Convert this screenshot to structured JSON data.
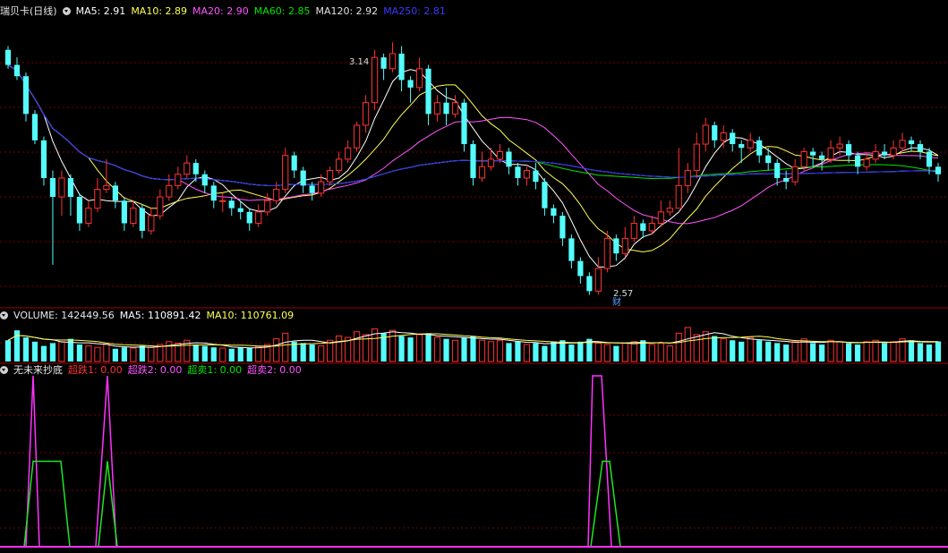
{
  "colors": {
    "up": "#ff3232",
    "down": "#54fcfc",
    "ma5": "#ffffff",
    "ma10": "#ffff54",
    "ma20": "#ff54ff",
    "ma60": "#00e600",
    "ma120": "#d8d8d8",
    "ma250": "#2a2aff",
    "grid": "#7a0000",
    "axis": "#a00000"
  },
  "price_header": {
    "title": "瑞贝卡(日线)",
    "ma5": "MA5: 2.91",
    "ma10": "MA10: 2.89",
    "ma20": "MA20: 2.90",
    "ma60": "MA60: 2.85",
    "ma120": "MA120: 2.92",
    "ma250": "MA250: 2.81"
  },
  "volume_header": {
    "volume": "VOLUME: 142449.56",
    "ma5": "MA5: 110891.42",
    "ma10": "MA10: 110761.09"
  },
  "indicator_header": {
    "name": "无未来抄底",
    "s1": "超跌1: 0.00",
    "s2": "超跌2: 0.00",
    "s3": "超卖1: 0.00",
    "s4": "超卖2: 0.00"
  },
  "chart_data": [
    {
      "type": "candlestick",
      "annotations": [
        {
          "text": "3.14",
          "kind": "high"
        },
        {
          "text": "2.57",
          "kind": "low"
        },
        {
          "text": "财",
          "kind": "marker"
        }
      ],
      "ohlc_sample_note": "",
      "candles": [
        [
          3.22,
          3.18,
          3.23,
          3.17
        ],
        [
          3.18,
          3.15,
          3.2,
          3.14
        ],
        [
          3.15,
          3.05,
          3.16,
          3.03
        ],
        [
          3.05,
          2.98,
          3.06,
          2.97
        ],
        [
          2.98,
          2.88,
          2.99,
          2.86
        ],
        [
          2.88,
          2.83,
          2.9,
          2.65
        ],
        [
          2.83,
          2.88,
          2.9,
          2.78
        ],
        [
          2.88,
          2.83,
          2.89,
          2.78
        ],
        [
          2.83,
          2.76,
          2.84,
          2.74
        ],
        [
          2.76,
          2.8,
          2.82,
          2.75
        ],
        [
          2.8,
          2.85,
          2.88,
          2.79
        ],
        [
          2.85,
          2.86,
          2.93,
          2.84
        ],
        [
          2.86,
          2.82,
          2.87,
          2.8
        ],
        [
          2.82,
          2.76,
          2.83,
          2.74
        ],
        [
          2.76,
          2.8,
          2.82,
          2.75
        ],
        [
          2.8,
          2.74,
          2.81,
          2.72
        ],
        [
          2.74,
          2.78,
          2.8,
          2.73
        ],
        [
          2.78,
          2.83,
          2.85,
          2.77
        ],
        [
          2.83,
          2.86,
          2.89,
          2.82
        ],
        [
          2.86,
          2.89,
          2.91,
          2.85
        ],
        [
          2.89,
          2.92,
          2.94,
          2.88
        ],
        [
          2.92,
          2.89,
          2.93,
          2.87
        ],
        [
          2.89,
          2.86,
          2.9,
          2.84
        ],
        [
          2.86,
          2.82,
          2.87,
          2.8
        ],
        [
          2.82,
          2.82,
          2.84,
          2.79
        ],
        [
          2.82,
          2.8,
          2.83,
          2.78
        ],
        [
          2.8,
          2.79,
          2.82,
          2.77
        ],
        [
          2.79,
          2.76,
          2.8,
          2.74
        ],
        [
          2.76,
          2.79,
          2.81,
          2.75
        ],
        [
          2.79,
          2.82,
          2.84,
          2.78
        ],
        [
          2.82,
          2.85,
          2.87,
          2.81
        ],
        [
          2.85,
          2.94,
          2.96,
          2.84
        ],
        [
          2.94,
          2.9,
          2.95,
          2.88
        ],
        [
          2.9,
          2.86,
          2.91,
          2.84
        ],
        [
          2.86,
          2.84,
          2.87,
          2.82
        ],
        [
          2.84,
          2.87,
          2.89,
          2.83
        ],
        [
          2.87,
          2.9,
          2.91,
          2.86
        ],
        [
          2.9,
          2.93,
          2.95,
          2.89
        ],
        [
          2.93,
          2.96,
          2.98,
          2.92
        ],
        [
          2.96,
          3.02,
          3.03,
          2.95
        ],
        [
          3.02,
          3.08,
          3.1,
          3.0
        ],
        [
          3.08,
          3.2,
          3.22,
          3.06
        ],
        [
          3.2,
          3.17,
          3.21,
          3.14
        ],
        [
          3.17,
          3.21,
          3.24,
          3.16
        ],
        [
          3.21,
          3.14,
          3.23,
          3.11
        ],
        [
          3.14,
          3.12,
          3.15,
          3.08
        ],
        [
          3.12,
          3.17,
          3.2,
          3.11
        ],
        [
          3.17,
          3.05,
          3.18,
          3.02
        ],
        [
          3.05,
          3.08,
          3.1,
          3.03
        ],
        [
          3.08,
          3.05,
          3.12,
          3.02
        ],
        [
          3.05,
          3.08,
          3.1,
          3.04
        ],
        [
          3.08,
          2.97,
          3.09,
          2.95
        ],
        [
          2.97,
          2.88,
          2.98,
          2.86
        ],
        [
          2.88,
          2.91,
          2.95,
          2.87
        ],
        [
          2.91,
          2.93,
          2.96,
          2.9
        ],
        [
          2.93,
          2.95,
          2.97,
          2.92
        ],
        [
          2.95,
          2.91,
          2.96,
          2.89
        ],
        [
          2.91,
          2.88,
          2.92,
          2.86
        ],
        [
          2.88,
          2.9,
          2.91,
          2.86
        ],
        [
          2.9,
          2.87,
          2.92,
          2.85
        ],
        [
          2.87,
          2.8,
          2.88,
          2.78
        ],
        [
          2.8,
          2.78,
          2.81,
          2.76
        ],
        [
          2.78,
          2.72,
          2.79,
          2.7
        ],
        [
          2.72,
          2.66,
          2.73,
          2.64
        ],
        [
          2.66,
          2.62,
          2.67,
          2.6
        ],
        [
          2.62,
          2.58,
          2.63,
          2.57
        ],
        [
          2.58,
          2.64,
          2.67,
          2.57
        ],
        [
          2.64,
          2.72,
          2.74,
          2.63
        ],
        [
          2.72,
          2.68,
          2.73,
          2.66
        ],
        [
          2.68,
          2.72,
          2.75,
          2.67
        ],
        [
          2.72,
          2.76,
          2.78,
          2.71
        ],
        [
          2.76,
          2.74,
          2.77,
          2.72
        ],
        [
          2.74,
          2.76,
          2.78,
          2.73
        ],
        [
          2.76,
          2.79,
          2.82,
          2.75
        ],
        [
          2.79,
          2.8,
          2.82,
          2.78
        ],
        [
          2.8,
          2.86,
          2.96,
          2.8
        ],
        [
          2.86,
          2.9,
          2.92,
          2.84
        ],
        [
          2.9,
          2.97,
          3.0,
          2.88
        ],
        [
          2.97,
          3.02,
          3.04,
          2.95
        ],
        [
          3.02,
          2.98,
          3.03,
          2.96
        ],
        [
          2.98,
          3.0,
          3.02,
          2.96
        ],
        [
          3.0,
          2.97,
          3.01,
          2.95
        ],
        [
          2.97,
          2.96,
          2.98,
          2.92
        ],
        [
          2.96,
          2.98,
          3.0,
          2.95
        ],
        [
          2.98,
          2.94,
          2.99,
          2.92
        ],
        [
          2.94,
          2.92,
          2.96,
          2.9
        ],
        [
          2.92,
          2.88,
          2.93,
          2.86
        ],
        [
          2.88,
          2.87,
          2.9,
          2.85
        ],
        [
          2.87,
          2.91,
          2.93,
          2.86
        ],
        [
          2.91,
          2.95,
          2.96,
          2.9
        ],
        [
          2.95,
          2.94,
          2.96,
          2.91
        ],
        [
          2.94,
          2.93,
          2.95,
          2.9
        ],
        [
          2.93,
          2.96,
          2.98,
          2.92
        ],
        [
          2.96,
          2.97,
          2.99,
          2.94
        ],
        [
          2.97,
          2.94,
          2.98,
          2.92
        ],
        [
          2.94,
          2.91,
          2.95,
          2.89
        ],
        [
          2.91,
          2.93,
          2.95,
          2.9
        ],
        [
          2.93,
          2.95,
          2.97,
          2.92
        ],
        [
          2.95,
          2.94,
          2.97,
          2.93
        ],
        [
          2.94,
          2.96,
          2.98,
          2.93
        ],
        [
          2.96,
          2.98,
          3.0,
          2.95
        ],
        [
          2.98,
          2.97,
          2.99,
          2.95
        ],
        [
          2.97,
          2.95,
          2.98,
          2.93
        ],
        [
          2.95,
          2.91,
          2.96,
          2.89
        ],
        [
          2.91,
          2.89,
          2.92,
          2.87
        ]
      ],
      "price_range": [
        2.55,
        3.3
      ]
    },
    {
      "type": "bar",
      "series_name": "VOLUME",
      "volumes": [
        150,
        220,
        170,
        140,
        110,
        130,
        140,
        160,
        120,
        110,
        100,
        120,
        90,
        100,
        95,
        110,
        100,
        120,
        140,
        130,
        150,
        120,
        110,
        100,
        95,
        90,
        100,
        95,
        105,
        120,
        160,
        200,
        140,
        130,
        120,
        110,
        150,
        180,
        170,
        210,
        190,
        230,
        200,
        220,
        180,
        170,
        190,
        200,
        170,
        160,
        150,
        170,
        180,
        150,
        140,
        150,
        130,
        140,
        120,
        130,
        110,
        140,
        150,
        120,
        140,
        160,
        130,
        120,
        110,
        130,
        140,
        150,
        120,
        130,
        110,
        200,
        240,
        190,
        210,
        180,
        160,
        150,
        140,
        170,
        150,
        140,
        130,
        120,
        140,
        160,
        130,
        120,
        150,
        140,
        130,
        120,
        140,
        150,
        130,
        140,
        160,
        150,
        130,
        120,
        142
      ]
    },
    {
      "type": "line",
      "series": [
        {
          "name": "超跌1",
          "values": []
        },
        {
          "name": "超跌2",
          "values": []
        },
        {
          "name": "超卖1",
          "values": []
        },
        {
          "name": "超卖2",
          "values": []
        }
      ],
      "signals": [
        {
          "color": "magenta",
          "points": [
            [
              0,
              0
            ],
            [
              29,
              0
            ],
            [
              37,
              1
            ],
            [
              44,
              0
            ],
            [
              107,
              0
            ],
            [
              120,
              1
            ],
            [
              130,
              0
            ],
            [
              657,
              0
            ],
            [
              662,
              1
            ],
            [
              672,
              1
            ],
            [
              683,
              0
            ],
            [
              1059,
              0
            ]
          ]
        },
        {
          "color": "green",
          "points": [
            [
              0,
              0
            ],
            [
              27,
              0
            ],
            [
              37,
              0.5
            ],
            [
              68,
              0.5
            ],
            [
              78,
              0
            ],
            [
              110,
              0
            ],
            [
              120,
              0.5
            ],
            [
              131,
              0
            ],
            [
              660,
              0
            ],
            [
              673,
              0.5
            ],
            [
              681,
              0.5
            ],
            [
              693,
              0
            ],
            [
              1059,
              0
            ]
          ]
        }
      ]
    }
  ]
}
